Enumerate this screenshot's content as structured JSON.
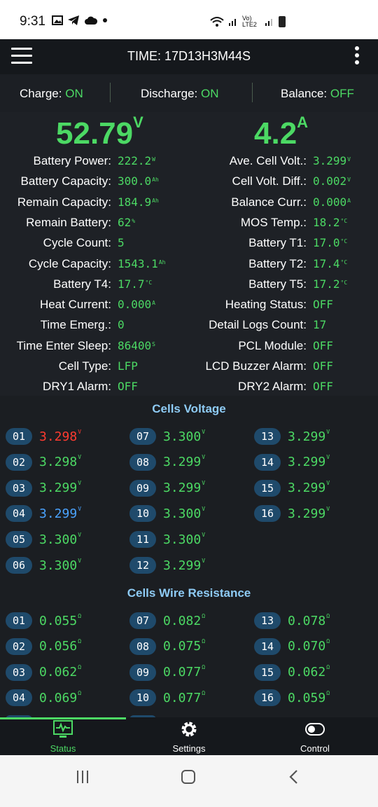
{
  "statusbar": {
    "time": "9:31",
    "net": "Vo) LTE2"
  },
  "appbar": {
    "title": "TIME: 17D13H3M44S"
  },
  "switches": {
    "charge_label": "Charge:",
    "charge_value": "ON",
    "discharge_label": "Discharge:",
    "discharge_value": "ON",
    "balance_label": "Balance:",
    "balance_value": "OFF"
  },
  "summary": {
    "voltage": "52.79",
    "voltage_unit": "V",
    "current": "4.2",
    "current_unit": "A"
  },
  "left_params": [
    {
      "label": "Battery Power:",
      "value": "222.2",
      "unit": "W"
    },
    {
      "label": "Battery Capacity:",
      "value": "300.0",
      "unit": "Ah"
    },
    {
      "label": "Remain Capacity:",
      "value": "184.9",
      "unit": "Ah"
    },
    {
      "label": "Remain Battery:",
      "value": "62",
      "unit": "%"
    },
    {
      "label": "Cycle Count:",
      "value": "5",
      "unit": ""
    },
    {
      "label": "Cycle Capacity:",
      "value": "1543.1",
      "unit": "Ah"
    },
    {
      "label": "Battery T4:",
      "value": "17.7",
      "unit": "°C"
    },
    {
      "label": "Heat Current:",
      "value": "0.000",
      "unit": "A"
    },
    {
      "label": "Time Emerg.:",
      "value": "0",
      "unit": ""
    },
    {
      "label": "Time Enter Sleep:",
      "value": "86400",
      "unit": "S"
    },
    {
      "label": "Cell Type:",
      "value": "LFP",
      "unit": ""
    },
    {
      "label": "DRY1 Alarm:",
      "value": "OFF",
      "unit": ""
    }
  ],
  "right_params": [
    {
      "label": "Ave. Cell Volt.:",
      "value": "3.299",
      "unit": "V"
    },
    {
      "label": "Cell Volt. Diff.:",
      "value": "0.002",
      "unit": "V"
    },
    {
      "label": "Balance Curr.:",
      "value": "0.000",
      "unit": "A"
    },
    {
      "label": "MOS Temp.:",
      "value": "18.2",
      "unit": "°C"
    },
    {
      "label": "Battery T1:",
      "value": "17.0",
      "unit": "°C"
    },
    {
      "label": "Battery T2:",
      "value": "17.4",
      "unit": "°C"
    },
    {
      "label": "Battery T5:",
      "value": "17.2",
      "unit": "°C"
    },
    {
      "label": "Heating Status:",
      "value": "OFF",
      "unit": ""
    },
    {
      "label": "Detail Logs Count:",
      "value": "17",
      "unit": ""
    },
    {
      "label": "PCL Module:",
      "value": "OFF",
      "unit": ""
    },
    {
      "label": "LCD Buzzer Alarm:",
      "value": "OFF",
      "unit": ""
    },
    {
      "label": "DRY2 Alarm:",
      "value": "OFF",
      "unit": ""
    }
  ],
  "cells_voltage": {
    "title": "Cells Voltage",
    "unit": "V",
    "cells": [
      {
        "n": "01",
        "v": "3.298",
        "color": "#ff3b30"
      },
      {
        "n": "02",
        "v": "3.298",
        "color": ""
      },
      {
        "n": "03",
        "v": "3.299",
        "color": ""
      },
      {
        "n": "04",
        "v": "3.299",
        "color": "#4aa3ff"
      },
      {
        "n": "05",
        "v": "3.300",
        "color": ""
      },
      {
        "n": "06",
        "v": "3.300",
        "color": ""
      },
      {
        "n": "07",
        "v": "3.300",
        "color": ""
      },
      {
        "n": "08",
        "v": "3.299",
        "color": ""
      },
      {
        "n": "09",
        "v": "3.299",
        "color": ""
      },
      {
        "n": "10",
        "v": "3.300",
        "color": ""
      },
      {
        "n": "11",
        "v": "3.300",
        "color": ""
      },
      {
        "n": "12",
        "v": "3.299",
        "color": ""
      },
      {
        "n": "13",
        "v": "3.299",
        "color": ""
      },
      {
        "n": "14",
        "v": "3.299",
        "color": ""
      },
      {
        "n": "15",
        "v": "3.299",
        "color": ""
      },
      {
        "n": "16",
        "v": "3.299",
        "color": ""
      }
    ]
  },
  "cells_resistance": {
    "title": "Cells Wire Resistance",
    "unit": "Ω",
    "cells": [
      {
        "n": "01",
        "v": "0.055"
      },
      {
        "n": "02",
        "v": "0.056"
      },
      {
        "n": "03",
        "v": "0.062"
      },
      {
        "n": "04",
        "v": "0.069"
      },
      {
        "n": "07",
        "v": "0.082"
      },
      {
        "n": "08",
        "v": "0.075"
      },
      {
        "n": "09",
        "v": "0.077"
      },
      {
        "n": "10",
        "v": "0.077"
      },
      {
        "n": "13",
        "v": "0.078"
      },
      {
        "n": "14",
        "v": "0.070"
      },
      {
        "n": "15",
        "v": "0.062"
      },
      {
        "n": "16",
        "v": "0.059"
      }
    ]
  },
  "bottomnav": {
    "status": "Status",
    "settings": "Settings",
    "control": "Control"
  },
  "colors": {
    "accent_green": "#4cd964",
    "section_title": "#8ecbf5",
    "badge": "#1f4a6b",
    "min_cell": "#ff3b30",
    "max_cell": "#4aa3ff"
  }
}
